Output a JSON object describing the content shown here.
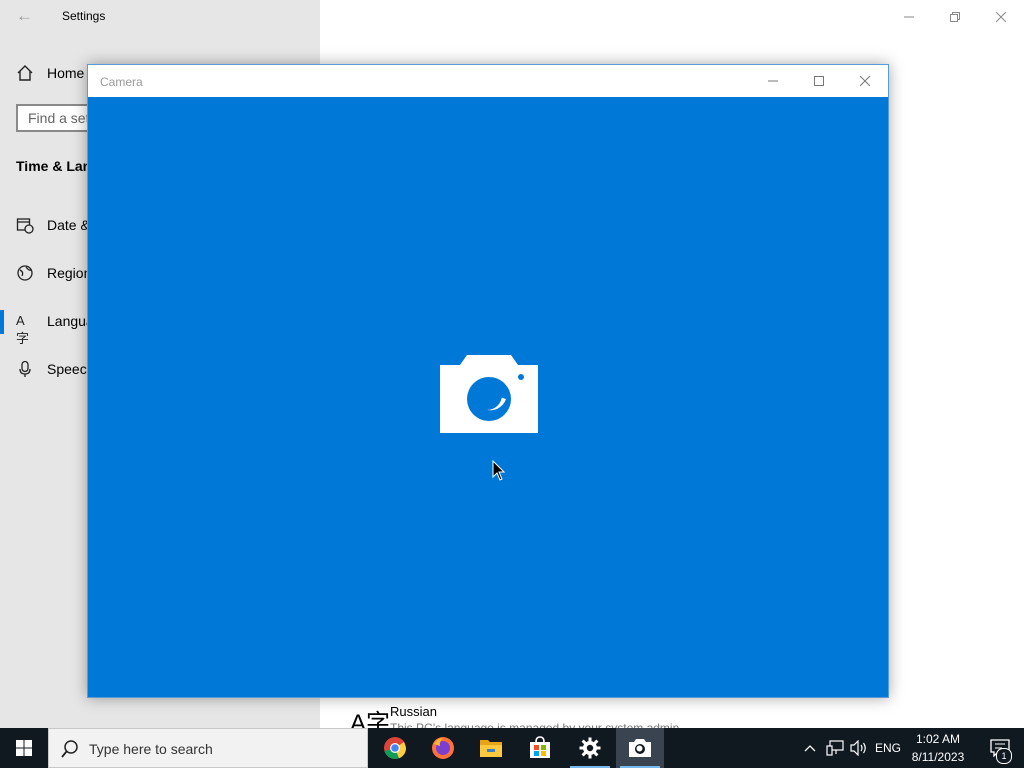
{
  "settings": {
    "title": "Settings",
    "home_label": "Home",
    "search_placeholder": "Find a set",
    "section_title": "Time & Lan",
    "nav": [
      {
        "label": "Date &",
        "icon": "date-time-icon"
      },
      {
        "label": "Region",
        "icon": "region-icon"
      },
      {
        "label": "Langua",
        "icon": "language-icon",
        "active": true
      },
      {
        "label": "Speech",
        "icon": "microphone-icon"
      }
    ],
    "language_item": {
      "name": "Russian",
      "description": "This PC’s language is managed by your system admin"
    }
  },
  "camera": {
    "title": "Camera",
    "accent": "#0078d7"
  },
  "taskbar": {
    "search_placeholder": "Type here to search",
    "apps": [
      "chrome",
      "firefox",
      "file-explorer",
      "microsoft-store",
      "settings",
      "camera"
    ],
    "language": "ENG",
    "time": "1:02 AM",
    "date": "8/11/2023",
    "notification_count": "1"
  }
}
